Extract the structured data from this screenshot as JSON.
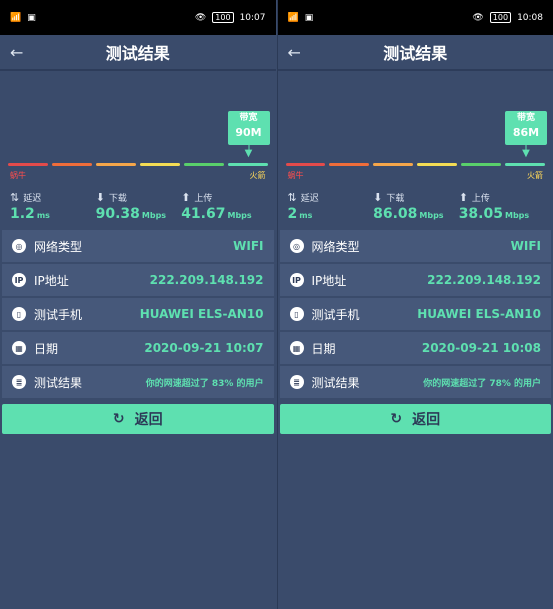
{
  "colors": {
    "bg": "#3a4b6b",
    "accent": "#5ee0b0",
    "row_bg": "#46587a",
    "warning_red": "#ff4d4d",
    "warning_yellow": "#ffd95a"
  },
  "screens": [
    {
      "status": {
        "time": "10:07",
        "battery": "100"
      },
      "header": {
        "title": "测试结果",
        "back_icon": "arrow-left-icon"
      },
      "meter": {
        "badge_label": "带宽",
        "badge_value": "90M",
        "left_label": "蜗牛",
        "right_label": "火箭"
      },
      "metrics": [
        {
          "label": "延迟",
          "value": "1.2",
          "unit": "ms",
          "icon": "updown-arrows-icon"
        },
        {
          "label": "下载",
          "value": "90.38",
          "unit": "Mbps",
          "icon": "download-icon"
        },
        {
          "label": "上传",
          "value": "41.67",
          "unit": "Mbps",
          "icon": "upload-icon"
        }
      ],
      "rows": [
        {
          "label": "网络类型",
          "value": "WIFI",
          "icon": "globe-icon"
        },
        {
          "label": "IP地址",
          "value": "222.209.148.192",
          "icon": "ip-icon"
        },
        {
          "label": "测试手机",
          "value": "HUAWEI ELS-AN10",
          "icon": "phone-icon"
        },
        {
          "label": "日期",
          "value": "2020-09-21 10:07",
          "icon": "calendar-icon"
        },
        {
          "label": "测试结果",
          "value": "你的网速超过了 83% 的用户",
          "icon": "document-icon"
        }
      ],
      "return_button": {
        "label": "返回",
        "icon": "refresh-icon"
      }
    },
    {
      "status": {
        "time": "10:08",
        "battery": "100"
      },
      "header": {
        "title": "测试结果",
        "back_icon": "arrow-left-icon"
      },
      "meter": {
        "badge_label": "带宽",
        "badge_value": "86M",
        "left_label": "蜗牛",
        "right_label": "火箭"
      },
      "metrics": [
        {
          "label": "延迟",
          "value": "2",
          "unit": "ms",
          "icon": "updown-arrows-icon"
        },
        {
          "label": "下载",
          "value": "86.08",
          "unit": "Mbps",
          "icon": "download-icon"
        },
        {
          "label": "上传",
          "value": "38.05",
          "unit": "Mbps",
          "icon": "upload-icon"
        }
      ],
      "rows": [
        {
          "label": "网络类型",
          "value": "WIFI",
          "icon": "globe-icon"
        },
        {
          "label": "IP地址",
          "value": "222.209.148.192",
          "icon": "ip-icon"
        },
        {
          "label": "测试手机",
          "value": "HUAWEI ELS-AN10",
          "icon": "phone-icon"
        },
        {
          "label": "日期",
          "value": "2020-09-21 10:08",
          "icon": "calendar-icon"
        },
        {
          "label": "测试结果",
          "value": "你的网速超过了 78% 的用户",
          "icon": "document-icon"
        }
      ],
      "return_button": {
        "label": "返回",
        "icon": "refresh-icon"
      }
    }
  ]
}
